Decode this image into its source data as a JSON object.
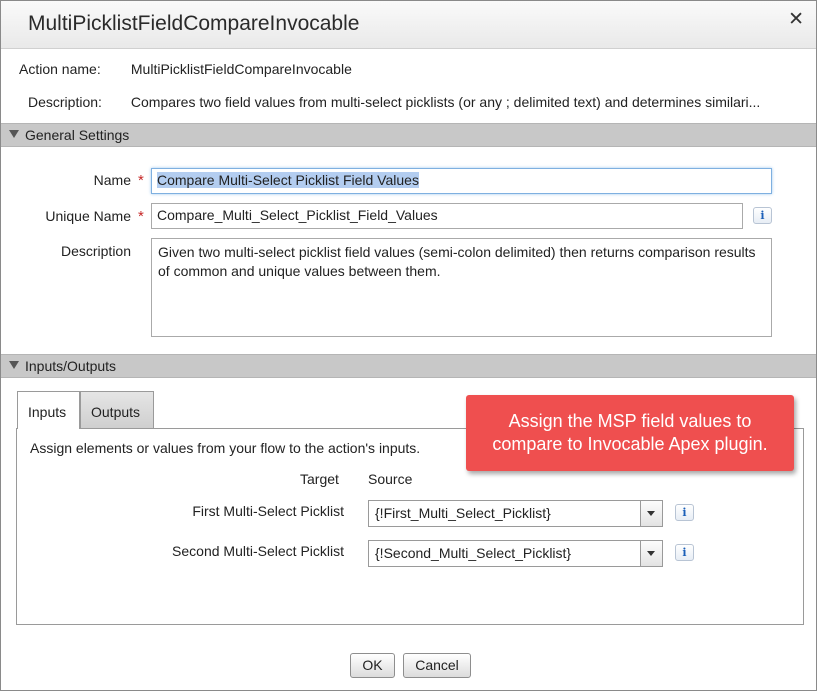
{
  "dialog": {
    "title": "MultiPicklistFieldCompareInvocable",
    "close_symbol": "✕"
  },
  "info": {
    "action_name_label": "Action name:",
    "action_name_value": "MultiPicklistFieldCompareInvocable",
    "description_label": "Description:",
    "description_value": "Compares two field values from multi-select picklists (or any ; delimited text) and determines similari..."
  },
  "general_settings": {
    "title": "General Settings",
    "name_label": "Name",
    "name_value": "Compare Multi-Select Picklist Field Values",
    "unique_name_label": "Unique Name",
    "unique_name_value": "Compare_Multi_Select_Picklist_Field_Values",
    "description_label": "Description",
    "description_value": "Given two multi-select picklist field values (semi-colon delimited) then returns comparison results of common and unique values between them.",
    "required_marker": "*",
    "info_symbol": "i"
  },
  "inputs_outputs": {
    "title": "Inputs/Outputs",
    "tabs": [
      {
        "label": "Inputs",
        "active": true
      },
      {
        "label": "Outputs",
        "active": false
      }
    ],
    "instructions": "Assign elements or values from your flow to the action's inputs.",
    "target_header": "Target",
    "source_header": "Source",
    "rows": [
      {
        "target": "First Multi-Select Picklist",
        "source": "{!First_Multi_Select_Picklist}"
      },
      {
        "target": "Second Multi-Select Picklist",
        "source": "{!Second_Multi_Select_Picklist}"
      }
    ],
    "info_symbol": "i"
  },
  "callout": {
    "line1": "Assign the MSP field values to",
    "line2": "compare to Invocable Apex plugin.",
    "color": "#ef4f4f"
  },
  "footer": {
    "ok_label": "OK",
    "cancel_label": "Cancel"
  }
}
